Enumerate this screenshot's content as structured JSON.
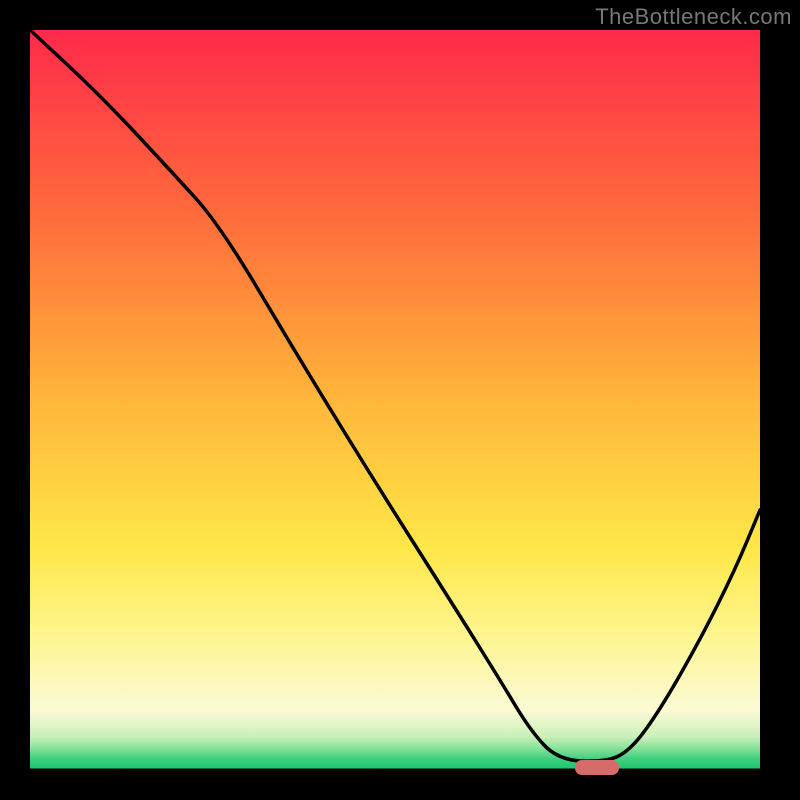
{
  "watermark": {
    "text": "TheBottleneck.com"
  },
  "chart_data": {
    "type": "line",
    "title": "",
    "xlabel": "",
    "ylabel": "",
    "xlim": [
      30,
      760
    ],
    "ylim": [
      770,
      30
    ],
    "gradient_stops": [
      {
        "offset": 0.0,
        "color": "#ff2a4a"
      },
      {
        "offset": 0.25,
        "color": "#ff6b3c"
      },
      {
        "offset": 0.5,
        "color": "#ffb63a"
      },
      {
        "offset": 0.7,
        "color": "#ffe748"
      },
      {
        "offset": 0.82,
        "color": "#fdf590"
      },
      {
        "offset": 0.92,
        "color": "#fbfad5"
      },
      {
        "offset": 0.955,
        "color": "#c9f0b8"
      },
      {
        "offset": 0.97,
        "color": "#8be29a"
      },
      {
        "offset": 0.985,
        "color": "#3fd07f"
      },
      {
        "offset": 1.0,
        "color": "#17c36d"
      }
    ],
    "curve": {
      "x": [
        30,
        100,
        170,
        220,
        300,
        380,
        450,
        500,
        530,
        558,
        605,
        630,
        660,
        700,
        735,
        760
      ],
      "y": [
        30,
        95,
        170,
        225,
        360,
        490,
        600,
        680,
        730,
        760,
        762,
        751,
        710,
        640,
        570,
        510
      ]
    },
    "flat_segment": {
      "x1": 558,
      "x2": 605,
      "y": 762
    },
    "marker": {
      "x": 575,
      "y": 760,
      "width": 44,
      "height": 15,
      "rx": 7,
      "fill": "#d66b6b"
    },
    "baseline_y": 770,
    "annotations": []
  }
}
